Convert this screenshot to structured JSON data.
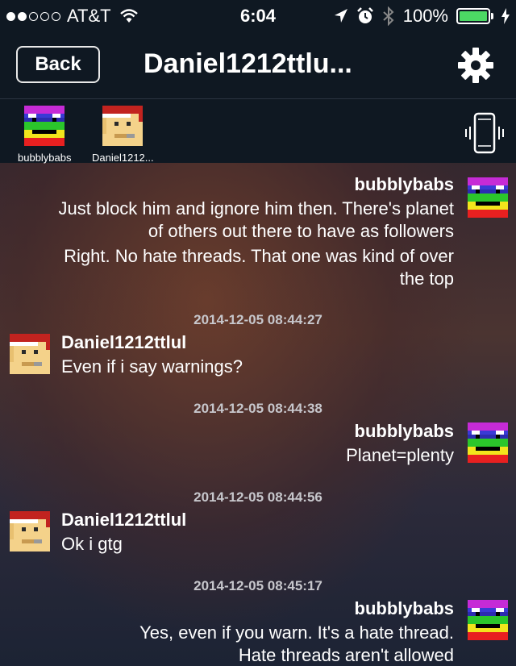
{
  "status_bar": {
    "carrier": "AT&T",
    "time": "6:04",
    "battery": "100%",
    "signal_bars": 2
  },
  "nav": {
    "back_label": "Back",
    "title": "Daniel1212ttlu...",
    "settings_icon": "gear-icon"
  },
  "participants": [
    {
      "name": "bubblybabs"
    },
    {
      "name": "Daniel1212..."
    }
  ],
  "messages": {
    "m1": {
      "sender": "bubblybabs",
      "lines": [
        "Just block him and ignore him then.  There's planet",
        "of others out there to have as followers",
        "Right.  No hate threads.  That one was kind of over",
        "the top"
      ]
    },
    "m2": {
      "timestamp": "2014-12-05 08:44:27",
      "sender": "Daniel1212ttlul",
      "text": "Even if i say warnings?"
    },
    "m3": {
      "timestamp": "2014-12-05 08:44:38",
      "sender": "bubblybabs",
      "text": "Planet=plenty"
    },
    "m4": {
      "timestamp": "2014-12-05 08:44:56",
      "sender": "Daniel1212ttlul",
      "text": "Ok i gtg"
    },
    "m5": {
      "timestamp": "2014-12-05 08:45:17",
      "sender": "bubblybabs",
      "lines": [
        "Yes, even if you warn.  It's a hate thread.",
        "Hate threads aren't allowed"
      ]
    }
  },
  "colors": {
    "battery_fill": "#4cd964",
    "topbar": "#0f1822",
    "timestamp": "#c7c7cc"
  }
}
